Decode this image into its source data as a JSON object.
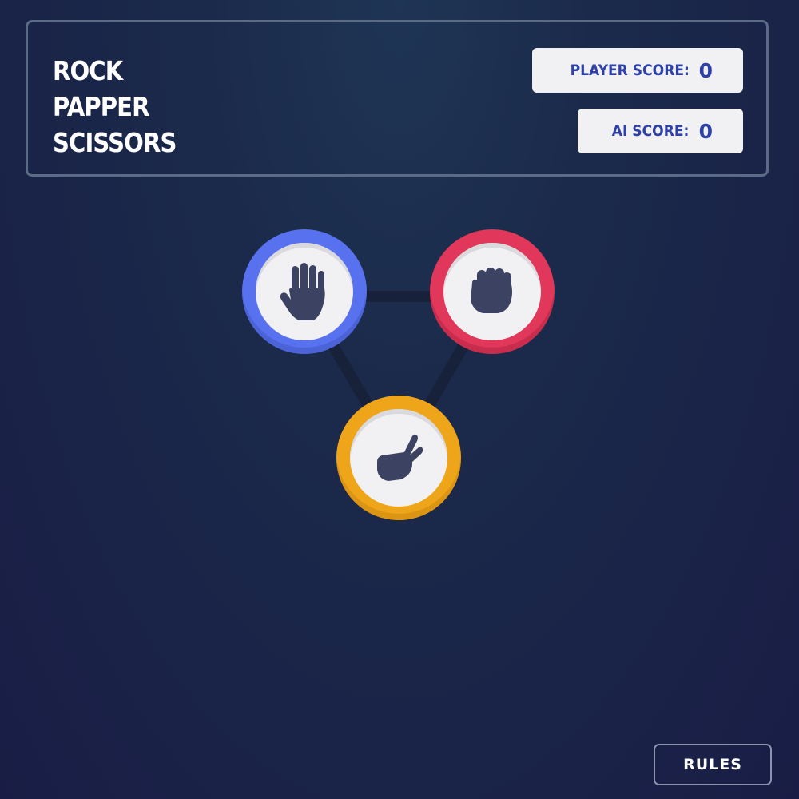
{
  "app": {
    "title_lines": [
      "ROCK",
      "PAPPER",
      "SCISSORS"
    ]
  },
  "scores": {
    "player_label": "PLAYER SCORE:",
    "player_value": "0",
    "ai_label": "AI SCORE:",
    "ai_value": "0"
  },
  "choices": [
    {
      "name": "paper",
      "icon": "open-hand-icon",
      "color": "#5872ef"
    },
    {
      "name": "rock",
      "icon": "fist-icon",
      "color": "#e0375a"
    },
    {
      "name": "scissors",
      "icon": "peace-hand-icon",
      "color": "#eea51a"
    }
  ],
  "footer": {
    "rules_label": "RULES"
  },
  "colors": {
    "background": "#1b2a4a",
    "score_text": "#2e41a8",
    "hand_icon": "#3b4262"
  }
}
